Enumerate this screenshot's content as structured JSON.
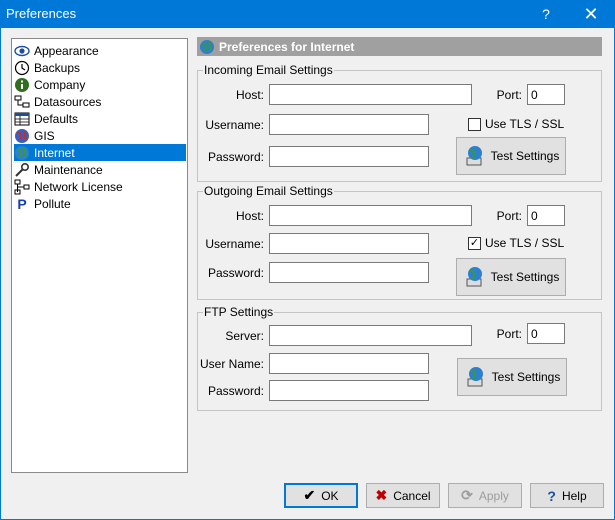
{
  "window": {
    "title": "Preferences",
    "help_glyph": "?",
    "close_glyph": "✕"
  },
  "tree": {
    "items": [
      {
        "label": "Appearance",
        "icon": "eye-icon",
        "selected": false
      },
      {
        "label": "Backups",
        "icon": "clock-icon",
        "selected": false
      },
      {
        "label": "Company",
        "icon": "info-icon",
        "selected": false
      },
      {
        "label": "Datasources",
        "icon": "network-icon",
        "selected": false
      },
      {
        "label": "Defaults",
        "icon": "table-icon",
        "selected": false
      },
      {
        "label": "GIS",
        "icon": "globe-icon",
        "selected": false
      },
      {
        "label": "Internet",
        "icon": "globe-icon",
        "selected": true
      },
      {
        "label": "Maintenance",
        "icon": "wrench-icon",
        "selected": false
      },
      {
        "label": "Network License",
        "icon": "network-icon",
        "selected": false
      },
      {
        "label": "Pollute",
        "icon": "p-icon",
        "selected": false
      }
    ]
  },
  "header": {
    "title": "Preferences for Internet",
    "icon": "globe-icon"
  },
  "incoming": {
    "legend": "Incoming Email Settings",
    "host_label": "Host:",
    "host_value": "",
    "port_label": "Port:",
    "port_value": "0",
    "username_label": "Username:",
    "username_value": "",
    "password_label": "Password:",
    "password_value": "",
    "tls_label": "Use TLS / SSL",
    "tls_checked": false,
    "test_label": "Test Settings"
  },
  "outgoing": {
    "legend": "Outgoing Email Settings",
    "host_label": "Host:",
    "host_value": "",
    "port_label": "Port:",
    "port_value": "0",
    "username_label": "Username:",
    "username_value": "",
    "password_label": "Password:",
    "password_value": "",
    "tls_label": "Use TLS / SSL",
    "tls_checked": true,
    "test_label": "Test Settings"
  },
  "ftp": {
    "legend": "FTP Settings",
    "server_label": "Server:",
    "server_value": "",
    "port_label": "Port:",
    "port_value": "0",
    "username_label": "User Name:",
    "username_value": "",
    "password_label": "Password:",
    "password_value": "",
    "test_label": "Test Settings"
  },
  "footer": {
    "ok_label": "OK",
    "cancel_label": "Cancel",
    "apply_label": "Apply",
    "help_label": "Help"
  },
  "colors": {
    "accent": "#0078d7",
    "header_bg": "#a0a0a0",
    "cancel_red": "#c00000"
  }
}
